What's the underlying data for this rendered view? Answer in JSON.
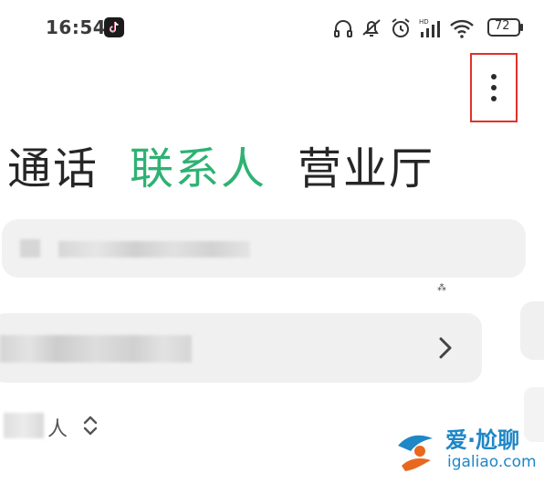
{
  "status_bar": {
    "time": "16:54",
    "battery": "72",
    "icons": [
      "tiktok-app-icon",
      "headphones-icon",
      "mute-icon",
      "alarm-icon",
      "hd-signal-icon",
      "wifi-icon",
      "battery-icon"
    ]
  },
  "menu": {
    "more_icon": "vertical-ellipsis-icon"
  },
  "tabs": [
    {
      "label": "通话",
      "active": false
    },
    {
      "label": "联系人",
      "active": true
    },
    {
      "label": "营业厅",
      "active": false
    }
  ],
  "colors": {
    "accent": "#2eb273",
    "highlight_box": "#e0312a",
    "watermark": "#1f87c6"
  },
  "contacts": {
    "sort_label": "人"
  },
  "misc": {
    "mark": "⁂"
  },
  "watermark": {
    "title": "爱·尬聊",
    "url": "igaliao.com"
  }
}
